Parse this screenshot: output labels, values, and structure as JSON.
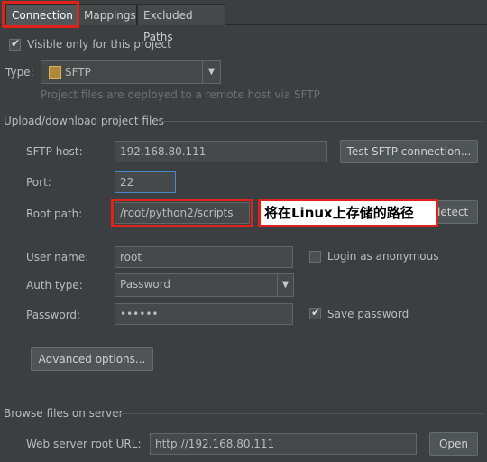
{
  "tabs": [
    {
      "label": "Connection"
    },
    {
      "label": "Mappings"
    },
    {
      "label": "Excluded Paths"
    }
  ],
  "visible_only": {
    "label": "Visible only for this project",
    "checked": true
  },
  "type": {
    "label": "Type:",
    "value": "SFTP",
    "hint": "Project files are deployed to a remote host via SFTP"
  },
  "upload_section": {
    "title": "Upload/download project files"
  },
  "sftp_host": {
    "label": "SFTP host:",
    "value": "192.168.80.111"
  },
  "test_button": {
    "label": "Test SFTP connection..."
  },
  "port": {
    "label": "Port:",
    "value": "22"
  },
  "root_path": {
    "label": "Root path:",
    "value": "/root/python2/scripts"
  },
  "autodetect_button": {
    "label": "detect"
  },
  "annotation": {
    "text": "将在Linux上存储的路径"
  },
  "user_name": {
    "label": "User name:",
    "value": "root"
  },
  "anonymous": {
    "label": "Login as anonymous",
    "checked": false
  },
  "auth_type": {
    "label": "Auth type:",
    "value": "Password"
  },
  "password": {
    "label": "Password:",
    "value": "••••••"
  },
  "save_password": {
    "label": "Save password",
    "checked": true
  },
  "advanced_button": {
    "label": "Advanced options..."
  },
  "browse_section": {
    "title": "Browse files on server"
  },
  "web_root": {
    "label": "Web server root URL:",
    "value": "http://192.168.80.111"
  },
  "open_button": {
    "label": "Open"
  },
  "colors": {
    "background": "#3c3f41",
    "highlight": "#e0221c",
    "text": "#bbbbbb"
  }
}
